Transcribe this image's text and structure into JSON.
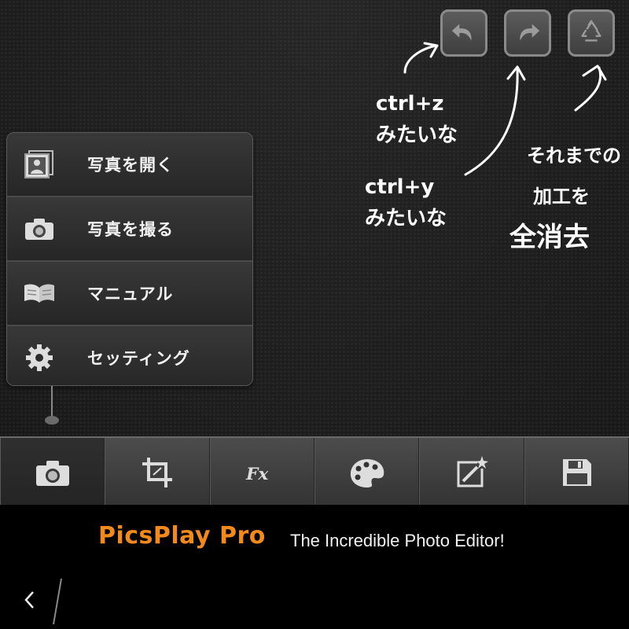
{
  "top_buttons": {
    "undo": {
      "icon": "undo-arrow-icon"
    },
    "redo": {
      "icon": "redo-arrow-icon"
    },
    "reset": {
      "icon": "recycle-icon"
    }
  },
  "menu": {
    "items": [
      {
        "label": "写真を開く",
        "icon": "photo-album-icon"
      },
      {
        "label": "写真を撮る",
        "icon": "camera-icon"
      },
      {
        "label": "マニュアル",
        "icon": "book-icon"
      },
      {
        "label": "セッティング",
        "icon": "gear-icon"
      }
    ]
  },
  "toolbar": {
    "items": [
      {
        "icon": "camera-icon",
        "active": true
      },
      {
        "icon": "crop-icon"
      },
      {
        "icon": "fx-icon"
      },
      {
        "icon": "palette-icon"
      },
      {
        "icon": "magic-frame-icon"
      },
      {
        "icon": "save-floppy-icon"
      }
    ]
  },
  "banner": {
    "brand": "PicsPlay Pro",
    "tagline": "The Incredible Photo Editor!"
  },
  "annotations": {
    "undo_note": [
      "ctrl+z",
      "みたいな"
    ],
    "redo_note": [
      "ctrl+y",
      "みたいな"
    ],
    "reset_note": [
      "それまでの",
      "加工を",
      "全消去"
    ]
  },
  "colors": {
    "brand": "#f18a1b",
    "background": "#262626"
  }
}
